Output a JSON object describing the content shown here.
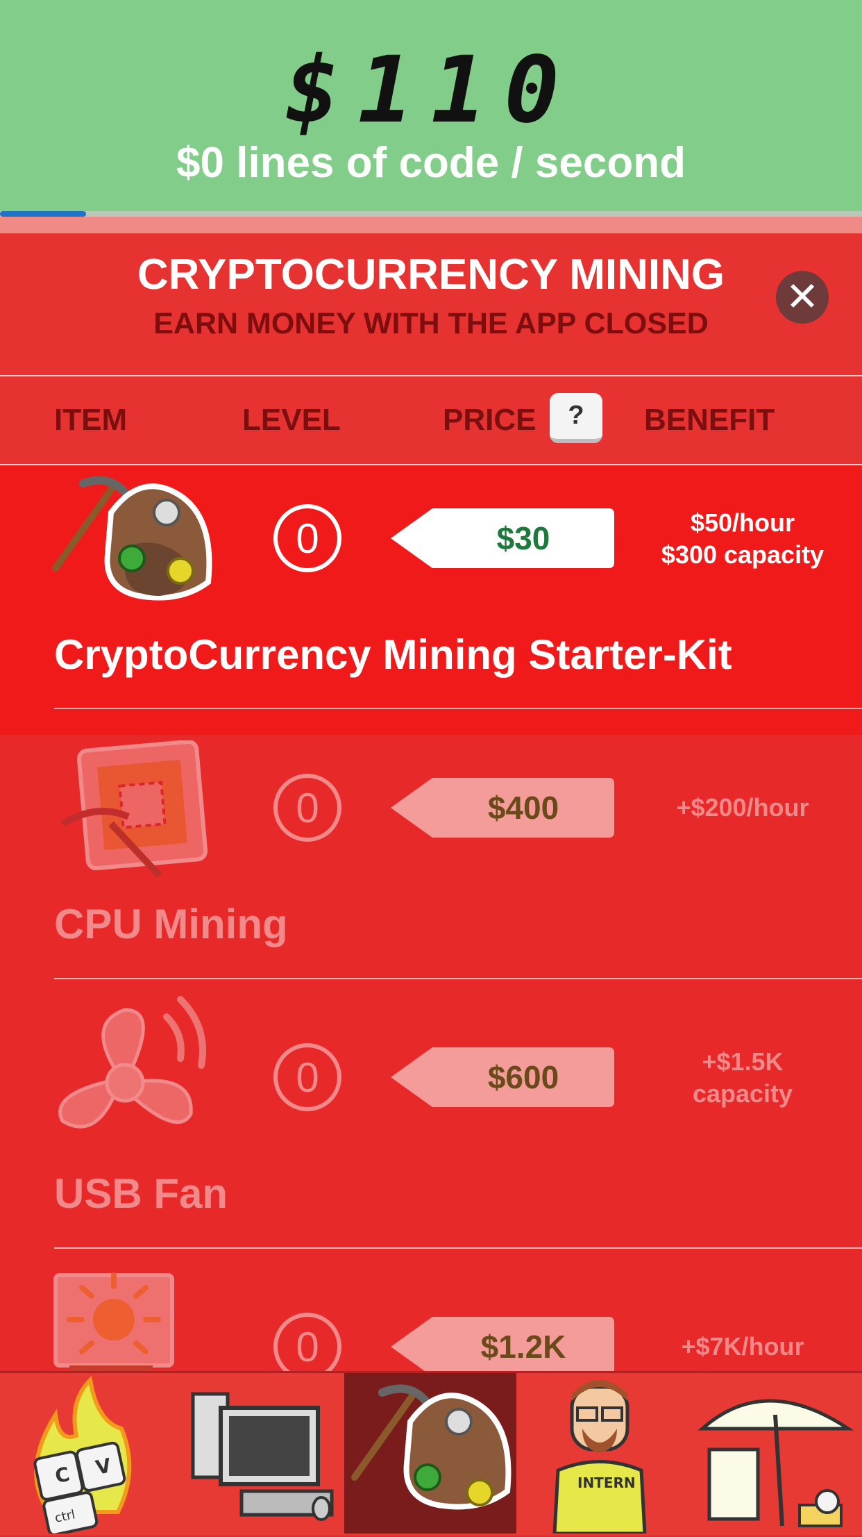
{
  "header": {
    "money": "$110",
    "rate": "$0 lines of code / second",
    "progress": 0.1
  },
  "modal": {
    "title": "CRYPTOCURRENCY MINING",
    "subtitle": "EARN MONEY WITH THE APP CLOSED"
  },
  "columns": {
    "item": "ITEM",
    "level": "LEVEL",
    "price": "PRICE",
    "help": "?",
    "benefit": "BENEFIT"
  },
  "items": [
    {
      "name": "CryptoCurrency Mining Starter-Kit",
      "level": "0",
      "price": "$30",
      "benefit_line1": "$50/hour",
      "benefit_line2": "$300 capacity",
      "icon": "pickaxe-rock-coins-icon"
    },
    {
      "name": "CPU Mining",
      "level": "0",
      "price": "$400",
      "benefit_line1": "+$200/hour",
      "benefit_line2": "",
      "icon": "cpu-pickaxe-icon"
    },
    {
      "name": "USB Fan",
      "level": "0",
      "price": "$600",
      "benefit_line1": "+$1.5K",
      "benefit_line2": "capacity",
      "icon": "fan-icon"
    },
    {
      "name": "",
      "level": "0",
      "price": "$1.2K",
      "benefit_line1": "+$7K/hour",
      "benefit_line2": "",
      "icon": "sun-painting-icon"
    }
  ],
  "nav": [
    {
      "icon": "keyboard-fire-icon"
    },
    {
      "icon": "computer-icon"
    },
    {
      "icon": "mining-icon",
      "active": true
    },
    {
      "icon": "intern-icon",
      "label": "INTERN"
    },
    {
      "icon": "beach-umbrella-icon"
    }
  ],
  "colors": {
    "header_green": "#82cd89",
    "panel_red": "#e8292a",
    "active_row": "#f11a1a",
    "price_green": "#1e7a3c",
    "price_brown": "#6b4a1a"
  }
}
